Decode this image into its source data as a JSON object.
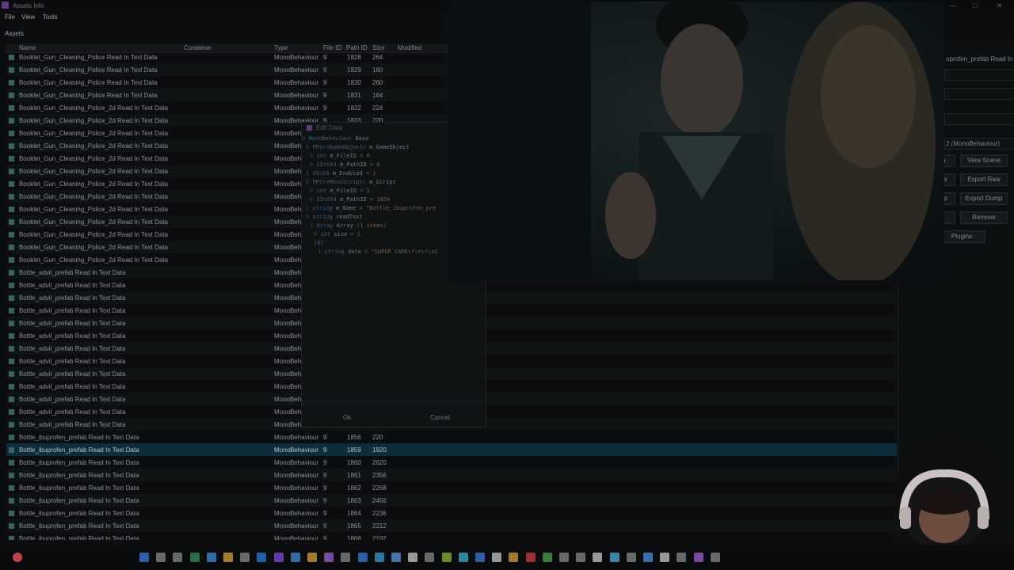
{
  "window": {
    "title": "Assets Info",
    "controls": [
      "—",
      "□",
      "✕"
    ]
  },
  "menu": [
    "File",
    "View",
    "Tools"
  ],
  "assets_label": "Assets",
  "columns": {
    "name": "Name",
    "container": "Container",
    "type": "Type",
    "file_id": "File ID",
    "path_id": "Path ID",
    "size": "Size",
    "modified": "Modified"
  },
  "rows": [
    {
      "name": "Booklet_Gun_Cleaning_Police Read In Text Data",
      "type": "MonoBehaviour",
      "file_id": "9",
      "path_id": "1828",
      "size": "264"
    },
    {
      "name": "Booklet_Gun_Cleaning_Police Read In Text Data",
      "type": "MonoBehaviour",
      "file_id": "9",
      "path_id": "1829",
      "size": "160"
    },
    {
      "name": "Booklet_Gun_Cleaning_Police Read In Text Data",
      "type": "MonoBehaviour",
      "file_id": "9",
      "path_id": "1830",
      "size": "260"
    },
    {
      "name": "Booklet_Gun_Cleaning_Police Read In Text Data",
      "type": "MonoBehaviour",
      "file_id": "9",
      "path_id": "1831",
      "size": "164"
    },
    {
      "name": "Booklet_Gun_Cleaning_Police_2d Read In Text Data",
      "type": "MonoBehaviour",
      "file_id": "9",
      "path_id": "1832",
      "size": "224"
    },
    {
      "name": "Booklet_Gun_Cleaning_Police_2d Read In Text Data",
      "type": "MonoBehaviour",
      "file_id": "9",
      "path_id": "1833",
      "size": "720"
    },
    {
      "name": "Booklet_Gun_Cleaning_Police_2d Read In Text Data",
      "type": "MonoBeh",
      "file_id": "",
      "path_id": "",
      "size": ""
    },
    {
      "name": "Booklet_Gun_Cleaning_Police_2d Read In Text Data",
      "type": "MonoBeh",
      "file_id": "",
      "path_id": "",
      "size": ""
    },
    {
      "name": "Booklet_Gun_Cleaning_Police_2d Read In Text Data",
      "type": "MonoBeh",
      "file_id": "",
      "path_id": "",
      "size": ""
    },
    {
      "name": "Booklet_Gun_Cleaning_Police_2d Read In Text Data",
      "type": "MonoBeh",
      "file_id": "",
      "path_id": "",
      "size": ""
    },
    {
      "name": "Booklet_Gun_Cleaning_Police_2d Read In Text Data",
      "type": "MonoBeh",
      "file_id": "",
      "path_id": "",
      "size": ""
    },
    {
      "name": "Booklet_Gun_Cleaning_Police_2d Read In Text Data",
      "type": "MonoBeh",
      "file_id": "",
      "path_id": "",
      "size": ""
    },
    {
      "name": "Booklet_Gun_Cleaning_Police_2d Read In Text Data",
      "type": "MonoBeh",
      "file_id": "",
      "path_id": "",
      "size": ""
    },
    {
      "name": "Booklet_Gun_Cleaning_Police_2d Read In Text Data",
      "type": "MonoBeh",
      "file_id": "",
      "path_id": "",
      "size": ""
    },
    {
      "name": "Booklet_Gun_Cleaning_Police_2d Read In Text Data",
      "type": "MonoBeh",
      "file_id": "",
      "path_id": "",
      "size": ""
    },
    {
      "name": "Booklet_Gun_Cleaning_Police_2d Read In Text Data",
      "type": "MonoBeh",
      "file_id": "",
      "path_id": "",
      "size": ""
    },
    {
      "name": "Booklet_Gun_Cleaning_Police_2d Read In Text Data",
      "type": "MonoBeh",
      "file_id": "",
      "path_id": "",
      "size": ""
    },
    {
      "name": "Bottle_advil_prefab Read In Text Data",
      "type": "MonoBeh",
      "file_id": "",
      "path_id": "",
      "size": ""
    },
    {
      "name": "Bottle_advil_prefab Read In Text Data",
      "type": "MonoBeh",
      "file_id": "",
      "path_id": "",
      "size": ""
    },
    {
      "name": "Bottle_advil_prefab Read In Text Data",
      "type": "MonoBeh",
      "file_id": "",
      "path_id": "",
      "size": ""
    },
    {
      "name": "Bottle_advil_prefab Read In Text Data",
      "type": "MonoBeh",
      "file_id": "",
      "path_id": "",
      "size": ""
    },
    {
      "name": "Bottle_advil_prefab Read In Text Data",
      "type": "MonoBeh",
      "file_id": "",
      "path_id": "",
      "size": ""
    },
    {
      "name": "Bottle_advil_prefab Read In Text Data",
      "type": "MonoBeh",
      "file_id": "",
      "path_id": "",
      "size": ""
    },
    {
      "name": "Bottle_advil_prefab Read In Text Data",
      "type": "MonoBeh",
      "file_id": "",
      "path_id": "",
      "size": ""
    },
    {
      "name": "Bottle_advil_prefab Read In Text Data",
      "type": "MonoBeh",
      "file_id": "",
      "path_id": "",
      "size": ""
    },
    {
      "name": "Bottle_advil_prefab Read In Text Data",
      "type": "MonoBeh",
      "file_id": "",
      "path_id": "",
      "size": ""
    },
    {
      "name": "Bottle_advil_prefab Read In Text Data",
      "type": "MonoBeh",
      "file_id": "",
      "path_id": "",
      "size": ""
    },
    {
      "name": "Bottle_advil_prefab Read In Text Data",
      "type": "MonoBeh",
      "file_id": "",
      "path_id": "",
      "size": ""
    },
    {
      "name": "Bottle_advil_prefab Read In Text Data",
      "type": "MonoBeh",
      "file_id": "",
      "path_id": "",
      "size": ""
    },
    {
      "name": "Bottle_advil_prefab Read In Text Data",
      "type": "MonoBeh",
      "file_id": "",
      "path_id": "",
      "size": ""
    },
    {
      "name": "Bottle_ibuprofen_prefab Read In Text Data",
      "type": "MonoBehaviour",
      "file_id": "9",
      "path_id": "1856",
      "size": "220"
    },
    {
      "name": "Bottle_ibuprofen_prefab Read In Text Data",
      "type": "MonoBehaviour",
      "file_id": "9",
      "path_id": "1859",
      "size": "1920",
      "selected": true
    },
    {
      "name": "Bottle_ibuprofen_prefab Read In Text Data",
      "type": "MonoBehaviour",
      "file_id": "9",
      "path_id": "1860",
      "size": "2620"
    },
    {
      "name": "Bottle_ibuprofen_prefab Read In Text Data",
      "type": "MonoBehaviour",
      "file_id": "9",
      "path_id": "1861",
      "size": "2356"
    },
    {
      "name": "Bottle_ibuprofen_prefab Read In Text Data",
      "type": "MonoBehaviour",
      "file_id": "9",
      "path_id": "1862",
      "size": "2268"
    },
    {
      "name": "Bottle_ibuprofen_prefab Read In Text Data",
      "type": "MonoBehaviour",
      "file_id": "9",
      "path_id": "1863",
      "size": "2456"
    },
    {
      "name": "Bottle_ibuprofen_prefab Read In Text Data",
      "type": "MonoBehaviour",
      "file_id": "9",
      "path_id": "1864",
      "size": "2236"
    },
    {
      "name": "Bottle_ibuprofen_prefab Read In Text Data",
      "type": "MonoBehaviour",
      "file_id": "9",
      "path_id": "1865",
      "size": "2212"
    },
    {
      "name": "Bottle_ibuprofen_prefab Read In Text Data",
      "type": "MonoBehaviour",
      "file_id": "9",
      "path_id": "1866",
      "size": "2192"
    }
  ],
  "right_panel": {
    "name_value": "uprofen_prefab Read In",
    "type_value": "2 (MonoBehaviour)",
    "buttons": [
      "ta",
      "View Scene",
      "aw",
      "Export Raw",
      "mp",
      "Export Dump",
      "a",
      "Remove",
      "Plugins"
    ]
  },
  "dialog": {
    "title": "Edit Data",
    "tree": [
      {
        "indent": 0,
        "prefix": "0",
        "type": "MonoBehaviour",
        "name": "Base",
        "value": ""
      },
      {
        "indent": 1,
        "prefix": "0",
        "type": "PPtr<GameObject>",
        "name": "m_GameObject",
        "value": ""
      },
      {
        "indent": 2,
        "prefix": "0",
        "type": "int",
        "name": "m_FileID",
        "value": "= 0"
      },
      {
        "indent": 2,
        "prefix": "0",
        "type": "SInt64",
        "name": "m_PathID",
        "value": "= 0"
      },
      {
        "indent": 1,
        "prefix": "1",
        "type": "UInt8",
        "name": "m_Enabled",
        "value": "= 1"
      },
      {
        "indent": 1,
        "prefix": "0",
        "type": "PPtr<MonoScript>",
        "name": "m_Script",
        "value": ""
      },
      {
        "indent": 2,
        "prefix": "0",
        "type": "int",
        "name": "m_FileID",
        "value": "= 1"
      },
      {
        "indent": 2,
        "prefix": "0",
        "type": "SInt64",
        "name": "m_PathID",
        "value": "= 1654"
      },
      {
        "indent": 1,
        "prefix": "1",
        "type": "string",
        "name": "m_Name",
        "value": "= \"Bottle_ibuprofen_pre"
      },
      {
        "indent": 1,
        "prefix": "0",
        "type": "string",
        "name": "readText",
        "value": ""
      },
      {
        "indent": 2,
        "prefix": "1",
        "type": "Array",
        "name": "Array",
        "value": "(1 items)"
      },
      {
        "indent": 3,
        "prefix": "0",
        "type": "int",
        "name": "size",
        "value": "= 1"
      },
      {
        "indent": 3,
        "prefix": "",
        "type": "[0]",
        "name": "",
        "value": ""
      },
      {
        "indent": 4,
        "prefix": "1",
        "type": "string",
        "name": "data",
        "value": "= \"SUPER CARE\\r\\n\\r\\nI"
      }
    ],
    "ok": "Ok",
    "cancel": "Cancel"
  },
  "taskbar": {
    "icon_colors": [
      "#3b7bd6",
      "#8a8a8a",
      "#8a8a8a",
      "#2f8f5a",
      "#3a8fd8",
      "#d8a83a",
      "#8a8a8a",
      "#2b7bd8",
      "#7a4fd6",
      "#4a8ad8",
      "#d6a03a",
      "#a060d0",
      "#8a8a8a",
      "#3a7bd0",
      "#3c9ad0",
      "#5a9ad8",
      "#c8c8c8",
      "#8a8a8a",
      "#8fb83a",
      "#3fb0d0",
      "#3a7bd6",
      "#c8c8c8",
      "#d6a03a",
      "#d04040",
      "#4aa050",
      "#8a8a8a",
      "#8a8a8a",
      "#c8c8c8",
      "#4ab0d8",
      "#8a8a8a",
      "#4a90e0",
      "#c8c8c8",
      "#8a8a8a",
      "#a060d0",
      "#8a8a8a"
    ]
  }
}
